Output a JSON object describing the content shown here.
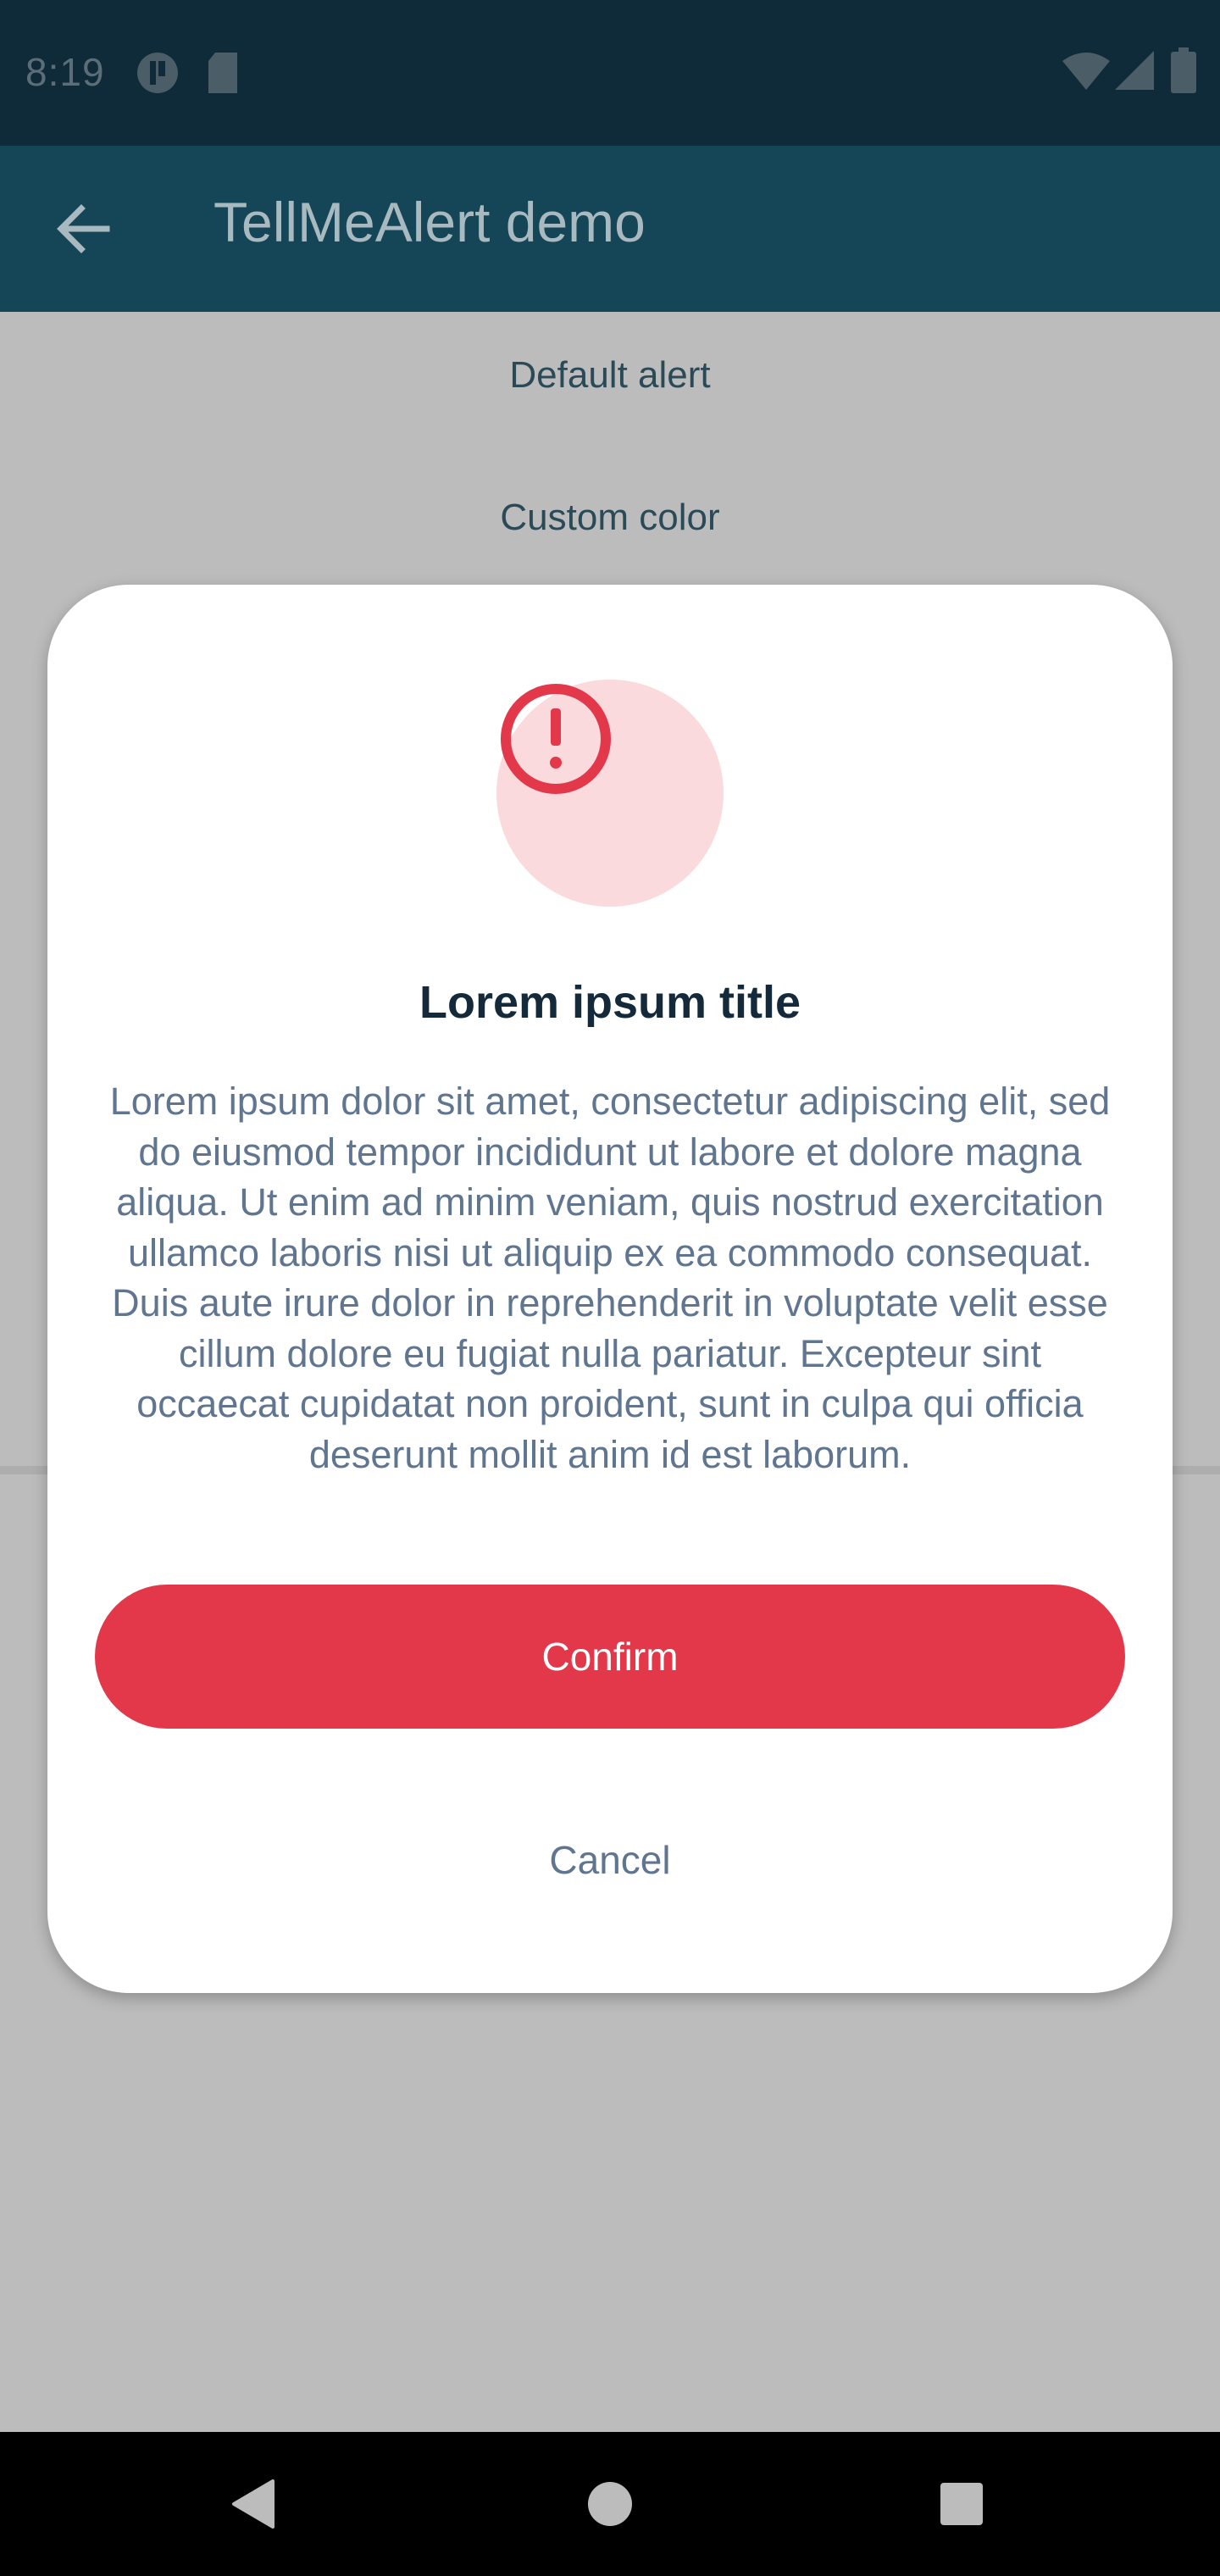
{
  "status_bar": {
    "time": "8:19",
    "icons": [
      "app-notification-icon",
      "sd-card-icon",
      "wifi-icon",
      "cellular-signal-icon",
      "battery-icon"
    ]
  },
  "app_bar": {
    "back_icon": "arrow-back-icon",
    "title": "TellMeAlert demo"
  },
  "background_list": {
    "items": [
      "Default alert",
      "Custom color"
    ]
  },
  "dialog": {
    "icon": "alert-circle-icon",
    "accent_color": "#e3374a",
    "icon_background_color": "#fadadd",
    "title": "Lorem ipsum title",
    "body": "Lorem ipsum dolor sit amet, consectetur adipiscing elit, sed do eiusmod tempor incididunt ut labore et dolore magna aliqua. Ut enim ad minim veniam, quis nostrud exercitation ullamco laboris nisi ut aliquip ex ea commodo consequat. Duis aute irure dolor in reprehenderit in voluptate velit esse cillum dolore eu fugiat nulla pariatur. Excepteur sint occaecat cupidatat non proident, sunt in culpa qui officia deserunt mollit anim id est laborum.",
    "confirm_label": "Confirm",
    "cancel_label": "Cancel"
  },
  "nav_bar": {
    "buttons": [
      "back-triangle-icon",
      "home-circle-icon",
      "recents-square-icon"
    ]
  }
}
